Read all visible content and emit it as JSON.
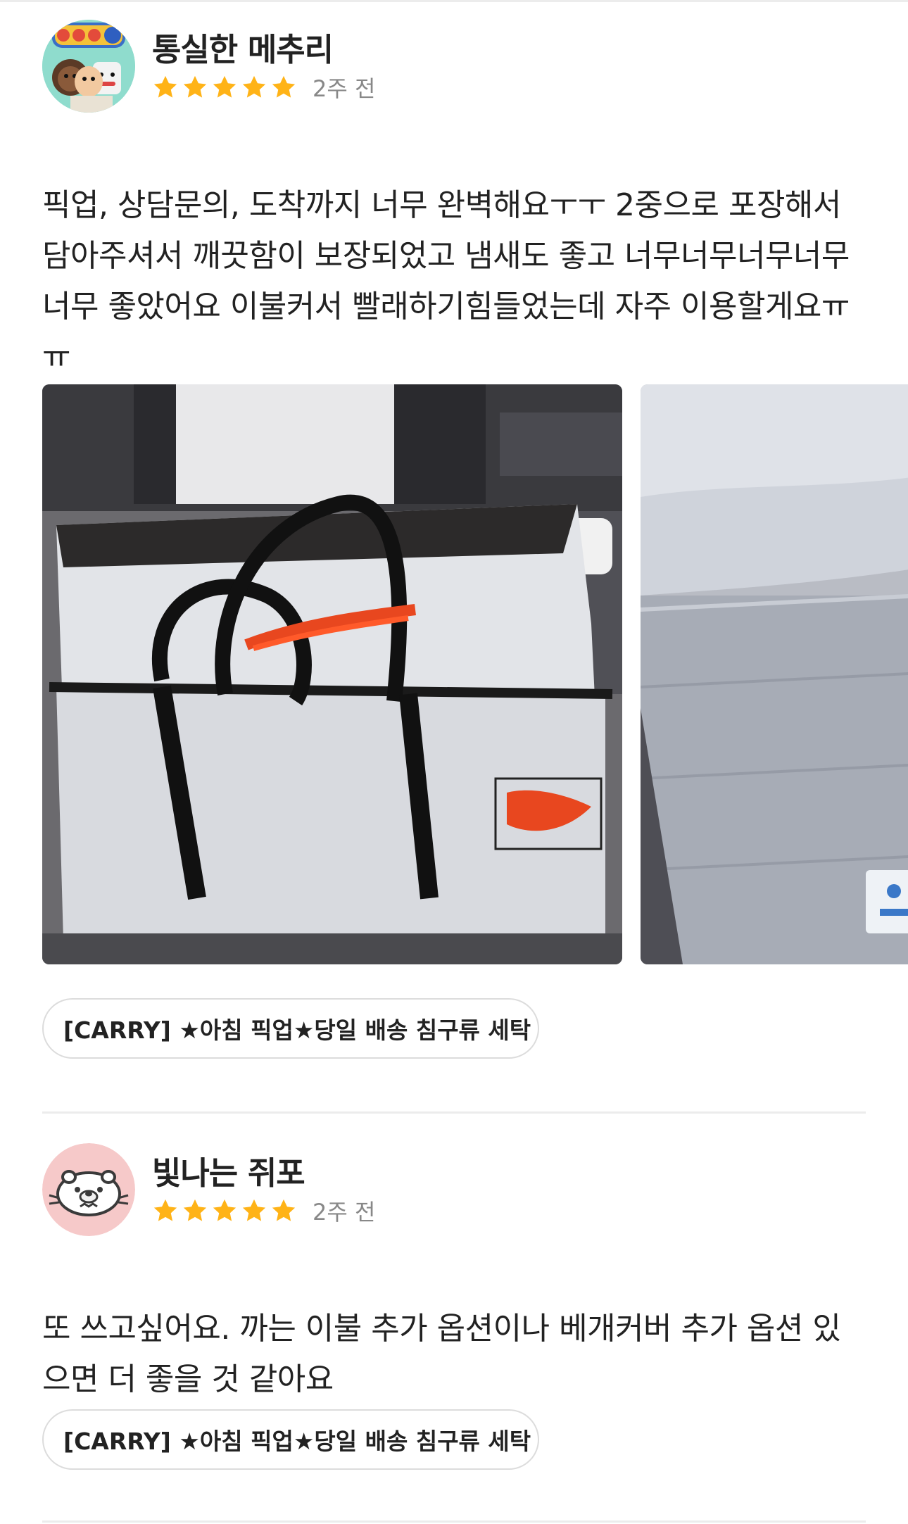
{
  "reviews": [
    {
      "author": "통실한 메추리",
      "rating": 5,
      "date": "2주 전",
      "text": "픽업, 상담문의, 도착까지 너무 완벽해요ㅜㅜ 2중으로 포장해서 담아주셔서 깨끗함이 보장되었고 냄새도 좋고 너무너무너무너무 너무 좋았어요 이불커서 빨래하기힘들었는데 자주 이용할게요ㅠㅠ",
      "avatar_icon": "cartoon-characters-avatar-icon",
      "photos": [
        "laundry-bag-photo",
        "packed-bedding-photo"
      ],
      "product": "[CARRY] ★아침 픽업★당일 배송 침구류 세탁"
    },
    {
      "author": "빛나는 쥐포",
      "rating": 5,
      "date": "2주 전",
      "text": "또 쓰고싶어요. 까는 이불 추가 옵션이나 베개커버 추가 옵션 있으면 더 좋을 것 같아요",
      "avatar_icon": "otter-avatar-icon",
      "product": "[CARRY] ★아침 픽업★당일 배송 침구류 세탁"
    }
  ],
  "colors": {
    "star": "#FFB317",
    "muted_text": "#888888",
    "divider": "#ECECEC",
    "chip_border": "#DCDCDC"
  }
}
